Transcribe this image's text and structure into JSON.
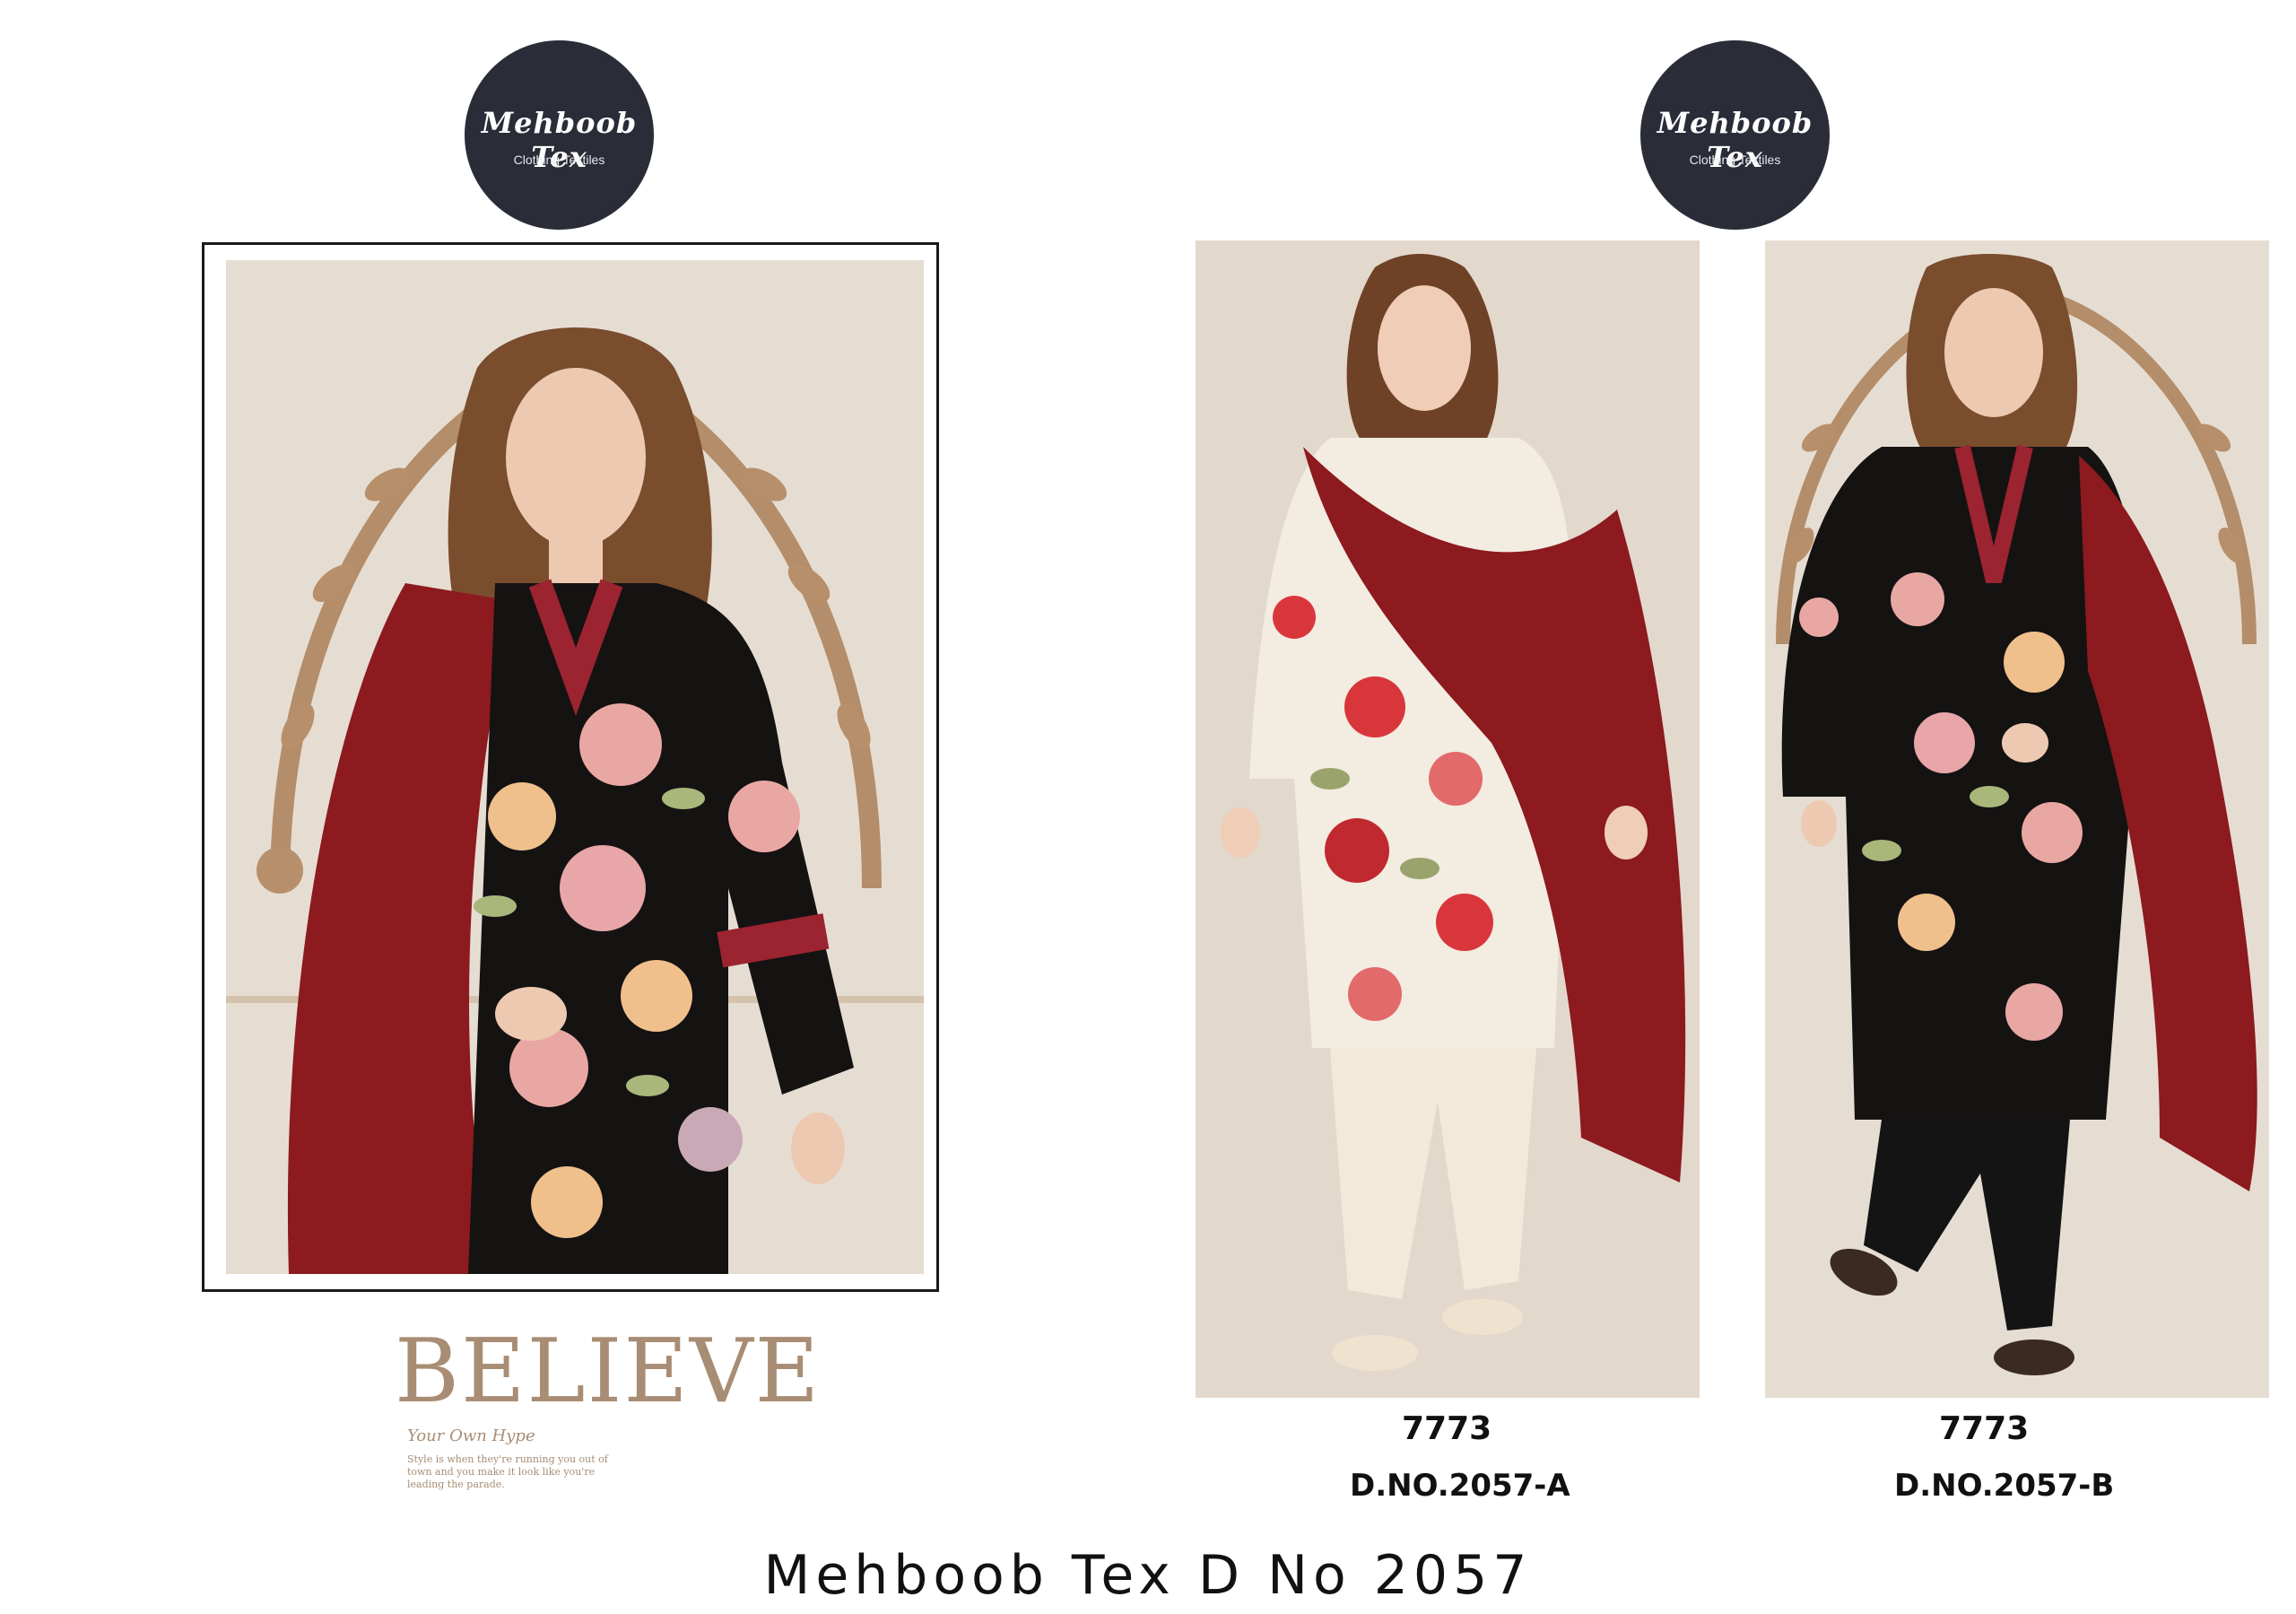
{
  "logos": [
    {
      "brand": "Mehboob Tex",
      "subtitle": "Clothing Textiles"
    },
    {
      "brand": "Mehboob Tex",
      "subtitle": "Clothing Textiles"
    }
  ],
  "believe": {
    "word": "BELIEVE",
    "tagline": "Your Own Hype",
    "small_text": "Style is when they're running you out of town and you make it look like you're leading the parade."
  },
  "products": [
    {
      "number": "7773",
      "design_no": "D.NO.2057-A"
    },
    {
      "number": "7773",
      "design_no": "D.NO.2057-B"
    }
  ],
  "footer": {
    "title": "Mehboob Tex D No 2057"
  },
  "colors": {
    "logo_bg": "#2a2c38",
    "dupatta_red": "#8c1a1f",
    "kurta_black": "#151212",
    "kurta_cream": "#f3ece0",
    "believe_gold": "#a88d74"
  }
}
